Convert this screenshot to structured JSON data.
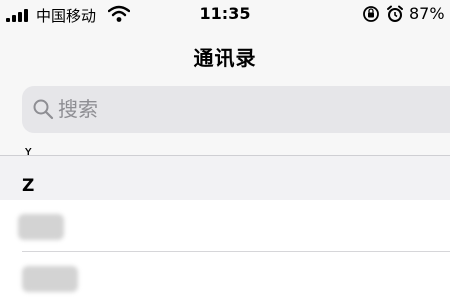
{
  "status_bar": {
    "carrier": "中国移动",
    "time": "11:35",
    "battery_percent": "87%",
    "icons": [
      "signal-bars-icon",
      "wifi-icon",
      "rotation-lock-icon",
      "alarm-icon"
    ]
  },
  "nav": {
    "title": "通讯录"
  },
  "search": {
    "placeholder": "搜索",
    "value": ""
  },
  "contacts": {
    "section_letter": "Z",
    "previous_section_letter": "Y",
    "rows": [
      {
        "name": ""
      },
      {
        "name": ""
      }
    ]
  },
  "colors": {
    "header_background": "#f7f7f7",
    "search_field_background": "#e6e6e9",
    "section_header_background": "#f2f2f4",
    "placeholder_text": "#8e8e93"
  }
}
